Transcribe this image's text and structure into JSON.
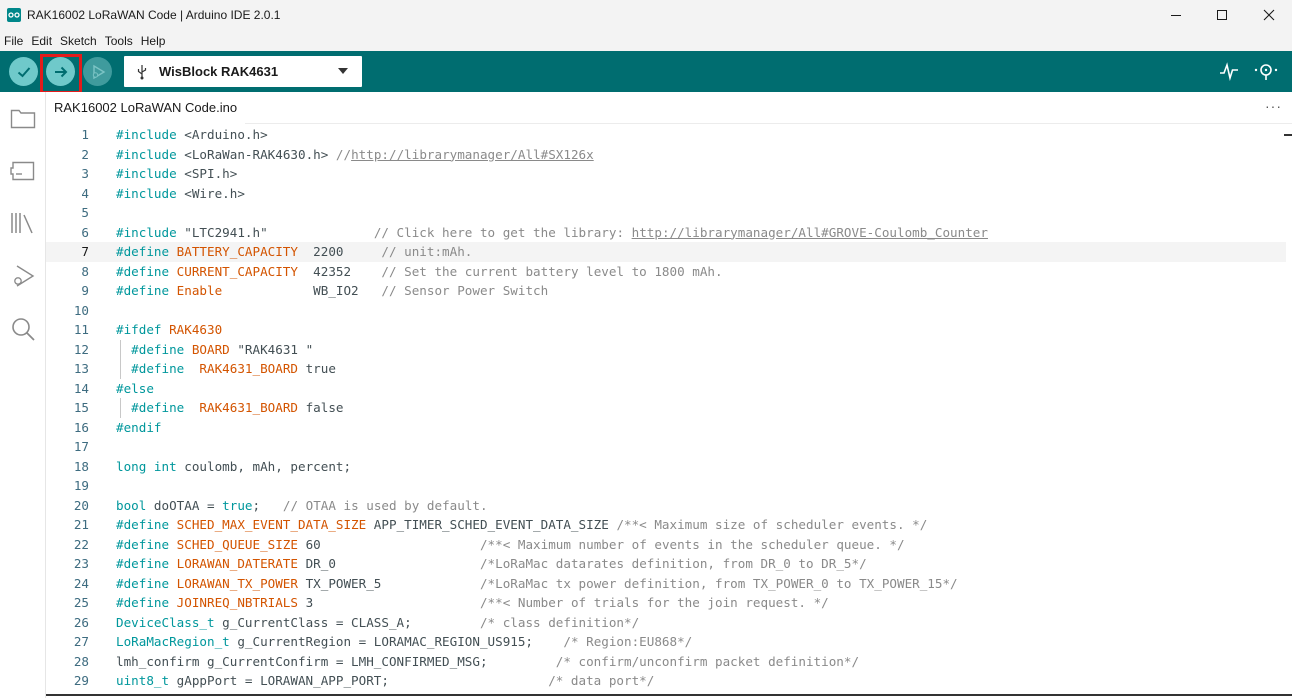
{
  "window": {
    "title": "RAK16002 LoRaWAN Code | Arduino IDE 2.0.1"
  },
  "menu": [
    "File",
    "Edit",
    "Sketch",
    "Tools",
    "Help"
  ],
  "toolbar": {
    "board": "WisBlock RAK4631"
  },
  "tab": {
    "filename": "RAK16002 LoRaWAN Code.ino",
    "more": "···"
  },
  "editor": {
    "current_line": 7,
    "lines": [
      {
        "n": "1",
        "parts": [
          [
            "k",
            "#include"
          ],
          [
            "n",
            " <Arduino.h>"
          ]
        ]
      },
      {
        "n": "2",
        "parts": [
          [
            "k",
            "#include"
          ],
          [
            "n",
            " <LoRaWan-RAK4630.h> "
          ],
          [
            "c",
            "//"
          ],
          [
            "u",
            "http://librarymanager/All#SX126x"
          ]
        ]
      },
      {
        "n": "3",
        "parts": [
          [
            "k",
            "#include"
          ],
          [
            "n",
            " <SPI.h>"
          ]
        ]
      },
      {
        "n": "4",
        "parts": [
          [
            "k",
            "#include"
          ],
          [
            "n",
            " <Wire.h>"
          ]
        ]
      },
      {
        "n": "5",
        "parts": []
      },
      {
        "n": "6",
        "parts": [
          [
            "k",
            "#include"
          ],
          [
            "n",
            " \"LTC2941.h\"              "
          ],
          [
            "c",
            "// Click here to get the library: "
          ],
          [
            "u",
            "http://librarymanager/All#GROVE-Coulomb_Counter"
          ]
        ]
      },
      {
        "n": "7",
        "parts": [
          [
            "k",
            "#define"
          ],
          [
            "r",
            " BATTERY_CAPACITY"
          ],
          [
            "n",
            "  2200     "
          ],
          [
            "c",
            "// unit:mAh."
          ]
        ]
      },
      {
        "n": "8",
        "parts": [
          [
            "k",
            "#define"
          ],
          [
            "r",
            " CURRENT_CAPACITY"
          ],
          [
            "n",
            "  42352    "
          ],
          [
            "c",
            "// Set the current battery level to 1800 mAh."
          ]
        ]
      },
      {
        "n": "9",
        "parts": [
          [
            "k",
            "#define"
          ],
          [
            "r",
            " Enable"
          ],
          [
            "n",
            "            WB_IO2   "
          ],
          [
            "c",
            "// Sensor Power Switch"
          ]
        ]
      },
      {
        "n": "10",
        "parts": []
      },
      {
        "n": "11",
        "parts": [
          [
            "k",
            "#ifdef"
          ],
          [
            "r",
            " RAK4630"
          ]
        ]
      },
      {
        "n": "12",
        "guide": true,
        "parts": [
          [
            "n",
            "  "
          ],
          [
            "k",
            "#define"
          ],
          [
            "r",
            " BOARD"
          ],
          [
            "n",
            " \"RAK4631 \""
          ]
        ]
      },
      {
        "n": "13",
        "guide": true,
        "parts": [
          [
            "n",
            "  "
          ],
          [
            "k",
            "#define"
          ],
          [
            "r",
            "  RAK4631_BOARD"
          ],
          [
            "n",
            " true"
          ]
        ]
      },
      {
        "n": "14",
        "parts": [
          [
            "k",
            "#else"
          ]
        ]
      },
      {
        "n": "15",
        "guide": true,
        "parts": [
          [
            "n",
            "  "
          ],
          [
            "k",
            "#define"
          ],
          [
            "r",
            "  RAK4631_BOARD"
          ],
          [
            "n",
            " false"
          ]
        ]
      },
      {
        "n": "16",
        "parts": [
          [
            "k",
            "#endif"
          ]
        ]
      },
      {
        "n": "17",
        "parts": []
      },
      {
        "n": "18",
        "parts": [
          [
            "k",
            "long int"
          ],
          [
            "n",
            " coulomb, mAh, percent;"
          ]
        ]
      },
      {
        "n": "19",
        "parts": []
      },
      {
        "n": "20",
        "parts": [
          [
            "k",
            "bool"
          ],
          [
            "n",
            " doOTAA = "
          ],
          [
            "k",
            "true"
          ],
          [
            "n",
            ";   "
          ],
          [
            "c",
            "// OTAA is used by default."
          ]
        ]
      },
      {
        "n": "21",
        "parts": [
          [
            "k",
            "#define"
          ],
          [
            "r",
            " SCHED_MAX_EVENT_DATA_SIZE"
          ],
          [
            "n",
            " APP_TIMER_SCHED_EVENT_DATA_SIZE "
          ],
          [
            "c",
            "/**< Maximum size of scheduler events. */"
          ]
        ]
      },
      {
        "n": "22",
        "parts": [
          [
            "k",
            "#define"
          ],
          [
            "r",
            " SCHED_QUEUE_SIZE"
          ],
          [
            "n",
            " 60                     "
          ],
          [
            "c",
            "/**< Maximum number of events in the scheduler queue. */"
          ]
        ]
      },
      {
        "n": "23",
        "parts": [
          [
            "k",
            "#define"
          ],
          [
            "r",
            " LORAWAN_DATERATE"
          ],
          [
            "n",
            " DR_0                   "
          ],
          [
            "c",
            "/*LoRaMac datarates definition, from DR_0 to DR_5*/"
          ]
        ]
      },
      {
        "n": "24",
        "parts": [
          [
            "k",
            "#define"
          ],
          [
            "r",
            " LORAWAN_TX_POWER"
          ],
          [
            "n",
            " TX_POWER_5             "
          ],
          [
            "c",
            "/*LoRaMac tx power definition, from TX_POWER_0 to TX_POWER_15*/"
          ]
        ]
      },
      {
        "n": "25",
        "parts": [
          [
            "k",
            "#define"
          ],
          [
            "r",
            " JOINREQ_NBTRIALS"
          ],
          [
            "n",
            " 3                      "
          ],
          [
            "c",
            "/**< Number of trials for the join request. */"
          ]
        ]
      },
      {
        "n": "26",
        "parts": [
          [
            "k",
            "DeviceClass_t"
          ],
          [
            "n",
            " g_CurrentClass = CLASS_A;         "
          ],
          [
            "c",
            "/* class definition*/"
          ]
        ]
      },
      {
        "n": "27",
        "parts": [
          [
            "k",
            "LoRaMacRegion_t"
          ],
          [
            "n",
            " g_CurrentRegion = LORAMAC_REGION_US915;    "
          ],
          [
            "c",
            "/* Region:EU868*/"
          ]
        ]
      },
      {
        "n": "28",
        "parts": [
          [
            "n",
            "lmh_confirm g_CurrentConfirm = LMH_CONFIRMED_MSG;         "
          ],
          [
            "c",
            "/* confirm/unconfirm packet definition*/"
          ]
        ]
      },
      {
        "n": "29",
        "parts": [
          [
            "k",
            "uint8_t"
          ],
          [
            "n",
            " gAppPort = LORAWAN_APP_PORT;                     "
          ],
          [
            "c",
            "/* data port*/"
          ]
        ]
      }
    ]
  }
}
